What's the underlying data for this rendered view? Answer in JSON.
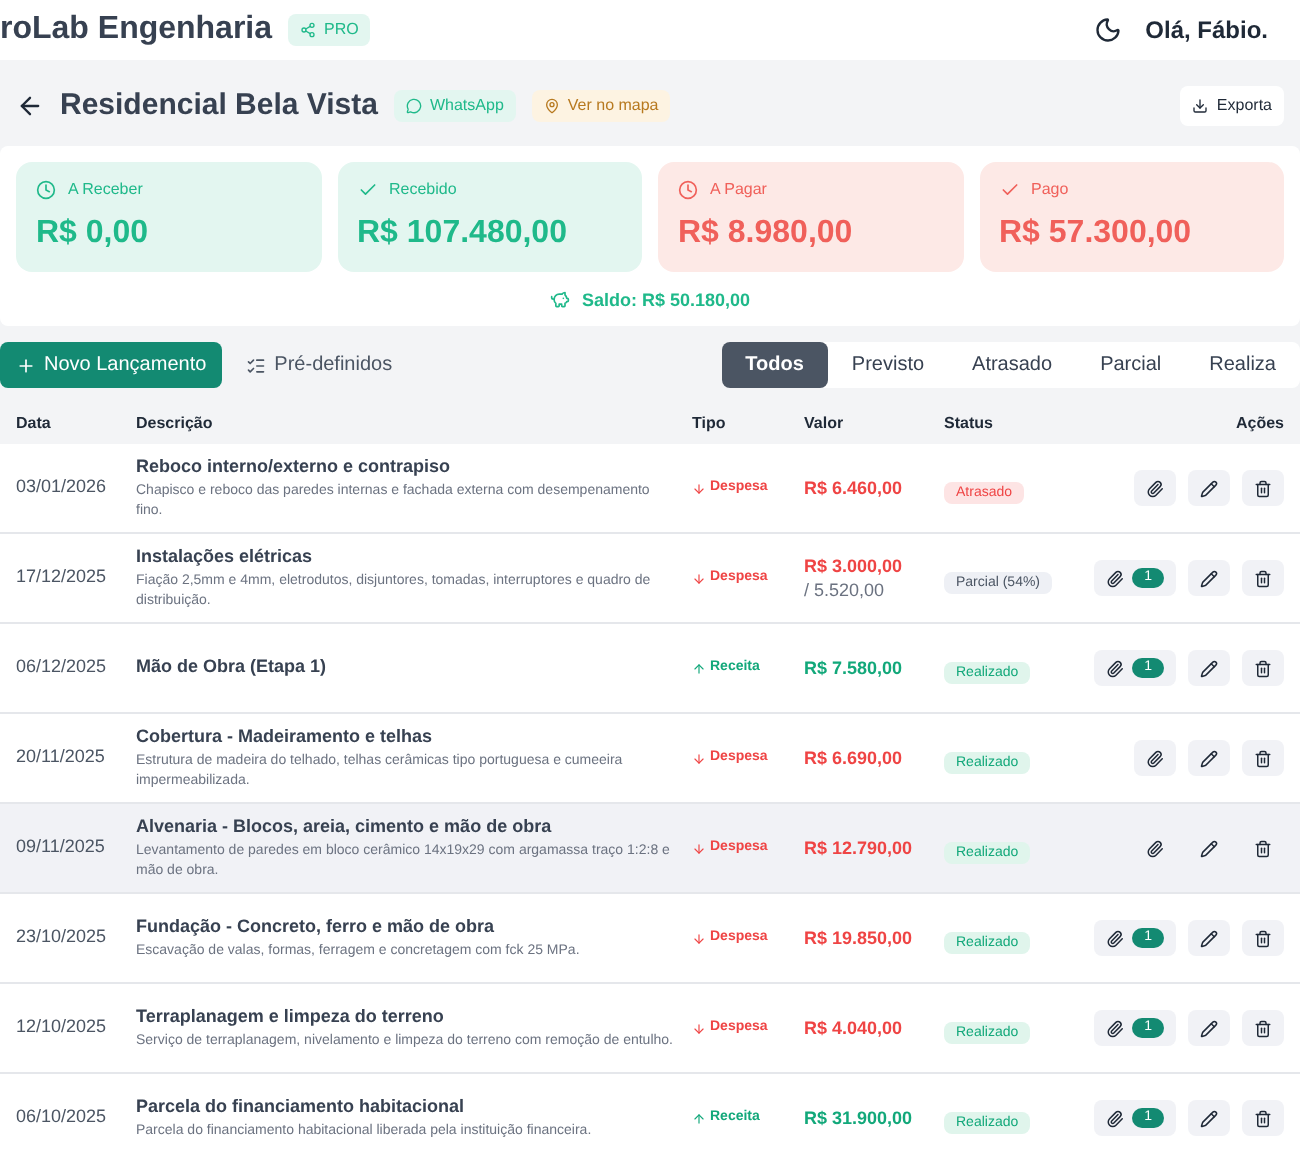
{
  "header": {
    "brand": "roLab Engenharia",
    "badge": "PRO",
    "greeting": "Olá, Fábio."
  },
  "project": {
    "title": "Residencial Bela Vista",
    "whatsapp": "WhatsApp",
    "map": "Ver no mapa",
    "export": "Exporta"
  },
  "cards": [
    {
      "kind": "receivable",
      "label": "A Receber",
      "amount": "R$ 0,00"
    },
    {
      "kind": "received",
      "label": "Recebido",
      "amount": "R$ 107.480,00"
    },
    {
      "kind": "payable",
      "label": "A Pagar",
      "amount": "R$ 8.980,00"
    },
    {
      "kind": "paid",
      "label": "Pago",
      "amount": "R$ 57.300,00"
    }
  ],
  "balance": "Saldo: R$ 50.180,00",
  "toolbar": {
    "new_entry": "Novo Lançamento",
    "presets": "Pré-definidos"
  },
  "tabs": [
    {
      "label": "Todos",
      "selected": true
    },
    {
      "label": "Previsto",
      "selected": false
    },
    {
      "label": "Atrasado",
      "selected": false
    },
    {
      "label": "Parcial",
      "selected": false
    },
    {
      "label": "Realiza",
      "selected": false
    }
  ],
  "table": {
    "columns": [
      "Data",
      "Descrição",
      "Tipo",
      "Valor",
      "Status",
      "Ações"
    ],
    "rows": [
      {
        "date": "03/01/2026",
        "title": "Reboco interno/externo e contrapiso",
        "description": "Chapisco e reboco das paredes internas e fachada externa com desempenamento fino.",
        "type": {
          "kind": "expense",
          "label": "Despesa"
        },
        "value": "R$ 6.460,00",
        "status": {
          "kind": "late",
          "label": "Atrasado"
        },
        "highlighted": false
      },
      {
        "date": "17/12/2025",
        "title": "Instalações elétricas",
        "description": "Fiação 2,5mm e 4mm, eletrodutos, disjuntores, tomadas, interruptores e quadro de distribuição.",
        "type": {
          "kind": "expense",
          "label": "Despesa"
        },
        "value": "R$ 3.000,00",
        "value_total": "/ 5.520,00",
        "status": {
          "kind": "partial",
          "label": "Parcial (54%)"
        },
        "attachments": "1",
        "highlighted": false
      },
      {
        "date": "06/12/2025",
        "title": "Mão de Obra (Etapa 1)",
        "type": {
          "kind": "income",
          "label": "Receita"
        },
        "value": "R$ 7.580,00",
        "status": {
          "kind": "done",
          "label": "Realizado"
        },
        "attachments": "1",
        "highlighted": false
      },
      {
        "date": "20/11/2025",
        "title": "Cobertura - Madeiramento e telhas",
        "description": "Estrutura de madeira do telhado, telhas cerâmicas tipo portuguesa e cumeeira impermeabilizada.",
        "type": {
          "kind": "expense",
          "label": "Despesa"
        },
        "value": "R$ 6.690,00",
        "status": {
          "kind": "done",
          "label": "Realizado"
        },
        "highlighted": false
      },
      {
        "date": "09/11/2025",
        "title": "Alvenaria - Blocos, areia, cimento e mão de obra",
        "description": "Levantamento de paredes em bloco cerâmico 14x19x29 com argamassa traço 1:2:8 e mão de obra.",
        "type": {
          "kind": "expense",
          "label": "Despesa"
        },
        "value": "R$ 12.790,00",
        "status": {
          "kind": "done",
          "label": "Realizado"
        },
        "highlighted": true
      },
      {
        "date": "23/10/2025",
        "title": "Fundação - Concreto, ferro e mão de obra",
        "description": "Escavação de valas, formas, ferragem e concretagem com fck 25 MPa.",
        "type": {
          "kind": "expense",
          "label": "Despesa"
        },
        "value": "R$ 19.850,00",
        "status": {
          "kind": "done",
          "label": "Realizado"
        },
        "attachments": "1",
        "highlighted": false
      },
      {
        "date": "12/10/2025",
        "title": "Terraplanagem e limpeza do terreno",
        "description": "Serviço de terraplanagem, nivelamento e limpeza do terreno com remoção de entulho.",
        "type": {
          "kind": "expense",
          "label": "Despesa"
        },
        "value": "R$ 4.040,00",
        "status": {
          "kind": "done",
          "label": "Realizado"
        },
        "attachments": "1",
        "highlighted": false
      },
      {
        "date": "06/10/2025",
        "title": "Parcela do financiamento habitacional",
        "description": "Parcela do financiamento habitacional liberada pela instituição financeira.",
        "type": {
          "kind": "income",
          "label": "Receita"
        },
        "value": "R$ 31.900,00",
        "status": {
          "kind": "done",
          "label": "Realizado"
        },
        "attachments": "1",
        "highlighted": false
      }
    ]
  }
}
